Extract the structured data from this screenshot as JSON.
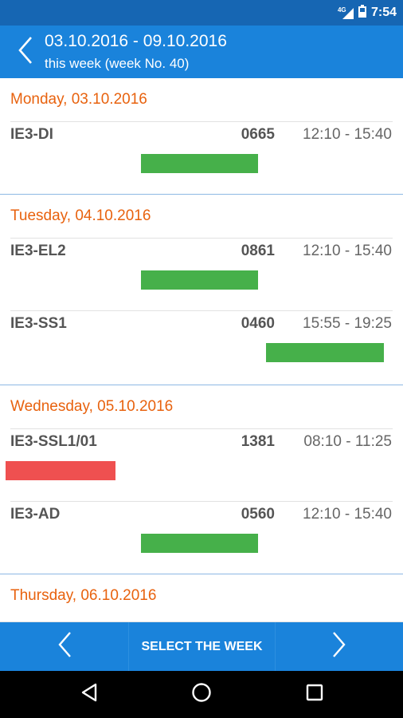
{
  "status_bar": {
    "time": "7:54",
    "network": "4G"
  },
  "header": {
    "title": "03.10.2016 - 09.10.2016",
    "subtitle": "this week (week No. 40)"
  },
  "days": [
    {
      "title": "Monday, 03.10.2016",
      "entries": [
        {
          "name": "IE3-DI",
          "room": "0665",
          "time": "12:10 - 15:40",
          "bar_color": "green"
        }
      ]
    },
    {
      "title": "Tuesday, 04.10.2016",
      "entries": [
        {
          "name": "IE3-EL2",
          "room": "0861",
          "time": "12:10 - 15:40",
          "bar_color": "green"
        },
        {
          "name": "IE3-SS1",
          "room": "0460",
          "time": "15:55 - 19:25",
          "bar_color": "green"
        }
      ]
    },
    {
      "title": "Wednesday, 05.10.2016",
      "entries": [
        {
          "name": "IE3-SSL1/01",
          "room": "1381",
          "time": "08:10 - 11:25",
          "bar_color": "red"
        },
        {
          "name": "IE3-AD",
          "room": "0560",
          "time": "12:10 - 15:40",
          "bar_color": "green"
        }
      ]
    },
    {
      "title": "Thursday, 06.10.2016",
      "entries": []
    }
  ],
  "bottom_bar": {
    "select_label": "SELECT THE WEEK"
  },
  "colors": {
    "header": "#1a83db",
    "status_bar": "#1666b3",
    "day_title": "#e8620e",
    "bar_green": "#46b04a",
    "bar_red": "#ef5050"
  },
  "icons": {
    "back": "chevron-left-icon",
    "prev_week": "chevron-left-icon",
    "next_week": "chevron-right-icon",
    "sys_back": "triangle-back-icon",
    "sys_home": "circle-home-icon",
    "sys_recents": "square-recents-icon"
  }
}
